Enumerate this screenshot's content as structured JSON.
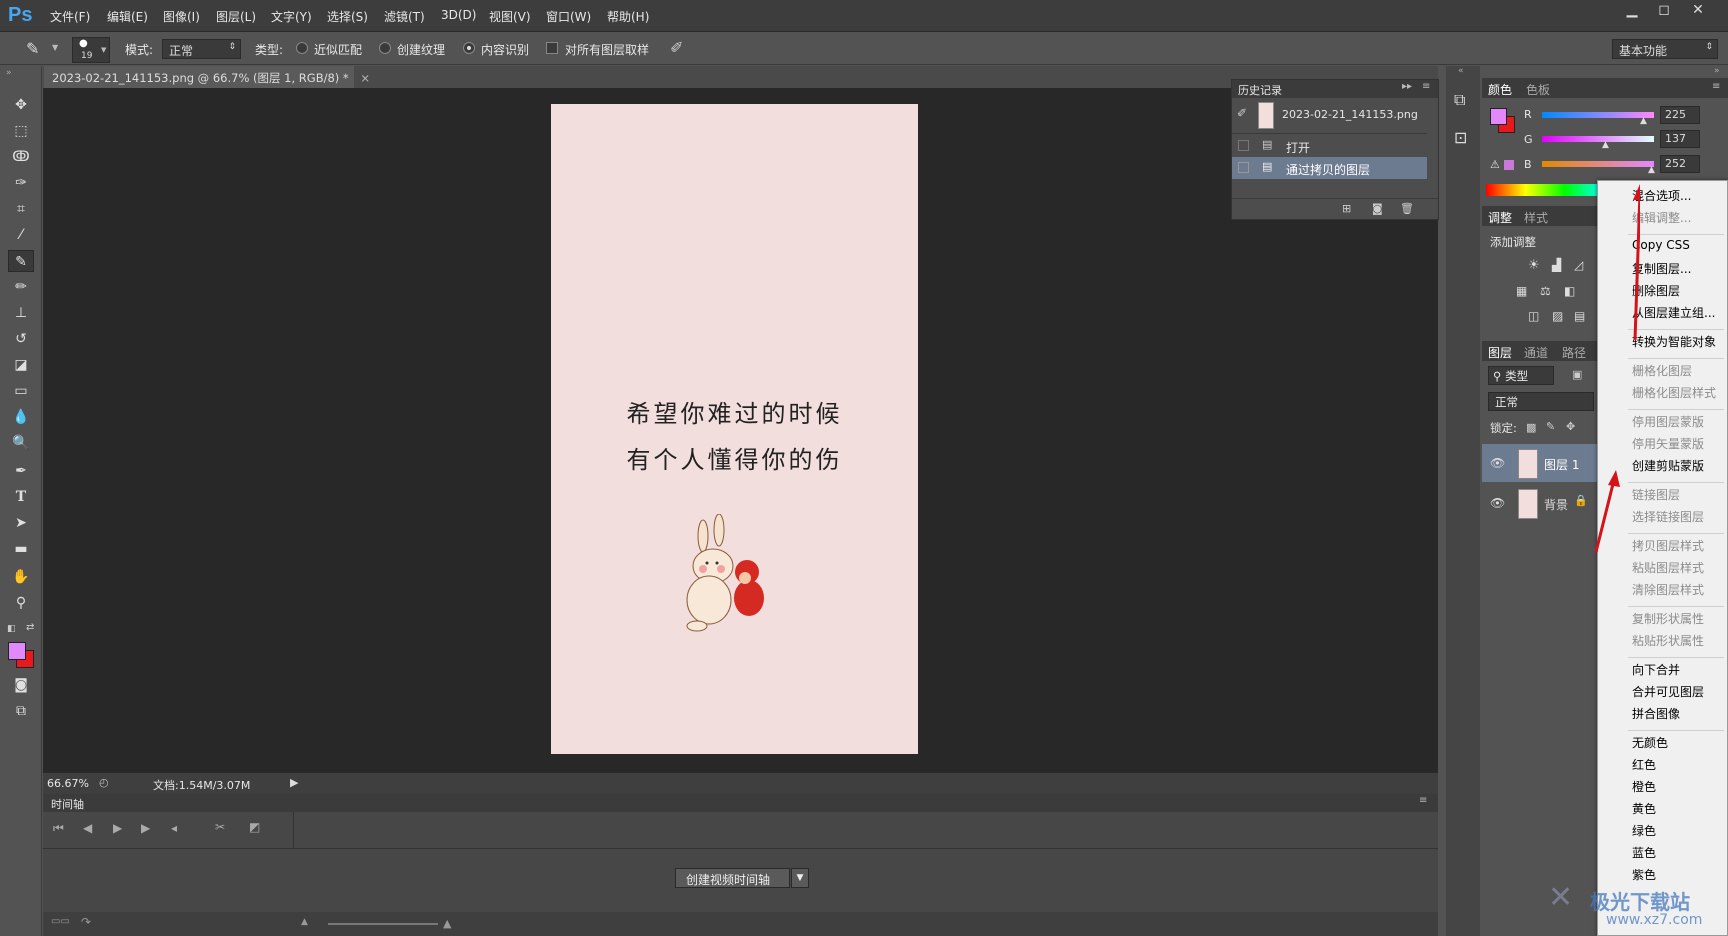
{
  "app": {
    "logo": "Ps"
  },
  "menu": [
    "文件(F)",
    "编辑(E)",
    "图像(I)",
    "图层(L)",
    "文字(Y)",
    "选择(S)",
    "滤镜(T)",
    "3D(D)",
    "视图(V)",
    "窗口(W)",
    "帮助(H)"
  ],
  "window_controls": {
    "minimize": "▁",
    "maximize": "◻",
    "close": "✕"
  },
  "options": {
    "brush_size": "19",
    "mode_label": "模式:",
    "mode_value": "正常",
    "type_label": "类型:",
    "radio_proximity": "近似匹配",
    "radio_texture": "创建纹理",
    "radio_content": "内容识别",
    "sample_all_layers": "对所有图层取样",
    "workspace": "基本功能"
  },
  "document": {
    "tab_title": "2023-02-21_141153.png @ 66.7% (图层 1, RGB/8) *",
    "poem_line1": "希望你难过的时候",
    "poem_line2": "有个人懂得你的伤",
    "zoom": "66.67%",
    "doc_size": "文档:1.54M/3.07M"
  },
  "timeline": {
    "title": "时间轴",
    "create_button": "创建视频时间轴"
  },
  "history": {
    "title": "历史记录",
    "snapshot": "2023-02-21_141153.png",
    "items": [
      "打开",
      "通过拷贝的图层"
    ]
  },
  "color_panel": {
    "tabs": [
      "颜色",
      "色板"
    ],
    "r_label": "R",
    "g_label": "G",
    "b_label": "B",
    "r": "225",
    "g": "137",
    "b": "252",
    "fg_color": "#e189fc",
    "bg_color": "#e8191c"
  },
  "adjust_panel": {
    "tabs": [
      "调整",
      "样式"
    ],
    "add_label": "添加调整"
  },
  "layers_panel": {
    "tabs": [
      "图层",
      "通道",
      "路径"
    ],
    "filter": "类型",
    "blend": "正常",
    "lock_label": "锁定:",
    "layers": [
      "图层 1",
      "背景"
    ]
  },
  "context_menu": {
    "groups": [
      [
        {
          "t": "混合选项...",
          "d": false
        },
        {
          "t": "编辑调整...",
          "d": true
        }
      ],
      [
        {
          "t": "Copy CSS",
          "d": false
        },
        {
          "t": "复制图层...",
          "d": false
        },
        {
          "t": "删除图层",
          "d": false
        },
        {
          "t": "从图层建立组...",
          "d": false
        }
      ],
      [
        {
          "t": "转换为智能对象",
          "d": false
        }
      ],
      [
        {
          "t": "栅格化图层",
          "d": true
        },
        {
          "t": "栅格化图层样式",
          "d": true
        }
      ],
      [
        {
          "t": "停用图层蒙版",
          "d": true
        },
        {
          "t": "停用矢量蒙版",
          "d": true
        },
        {
          "t": "创建剪贴蒙版",
          "d": false
        }
      ],
      [
        {
          "t": "链接图层",
          "d": true
        },
        {
          "t": "选择链接图层",
          "d": true
        }
      ],
      [
        {
          "t": "拷贝图层样式",
          "d": true
        },
        {
          "t": "粘贴图层样式",
          "d": true
        },
        {
          "t": "清除图层样式",
          "d": true
        }
      ],
      [
        {
          "t": "复制形状属性",
          "d": true
        },
        {
          "t": "粘贴形状属性",
          "d": true
        }
      ],
      [
        {
          "t": "向下合并",
          "d": false
        },
        {
          "t": "合并可见图层",
          "d": false
        },
        {
          "t": "拼合图像",
          "d": false
        }
      ],
      [
        {
          "t": "无颜色",
          "d": false
        },
        {
          "t": "红色",
          "d": false
        },
        {
          "t": "橙色",
          "d": false
        },
        {
          "t": "黄色",
          "d": false
        },
        {
          "t": "绿色",
          "d": false
        },
        {
          "t": "蓝色",
          "d": false
        },
        {
          "t": "紫色",
          "d": false
        }
      ]
    ]
  },
  "watermark": {
    "text": "极光下载站",
    "sub": "www.xz7.com"
  }
}
